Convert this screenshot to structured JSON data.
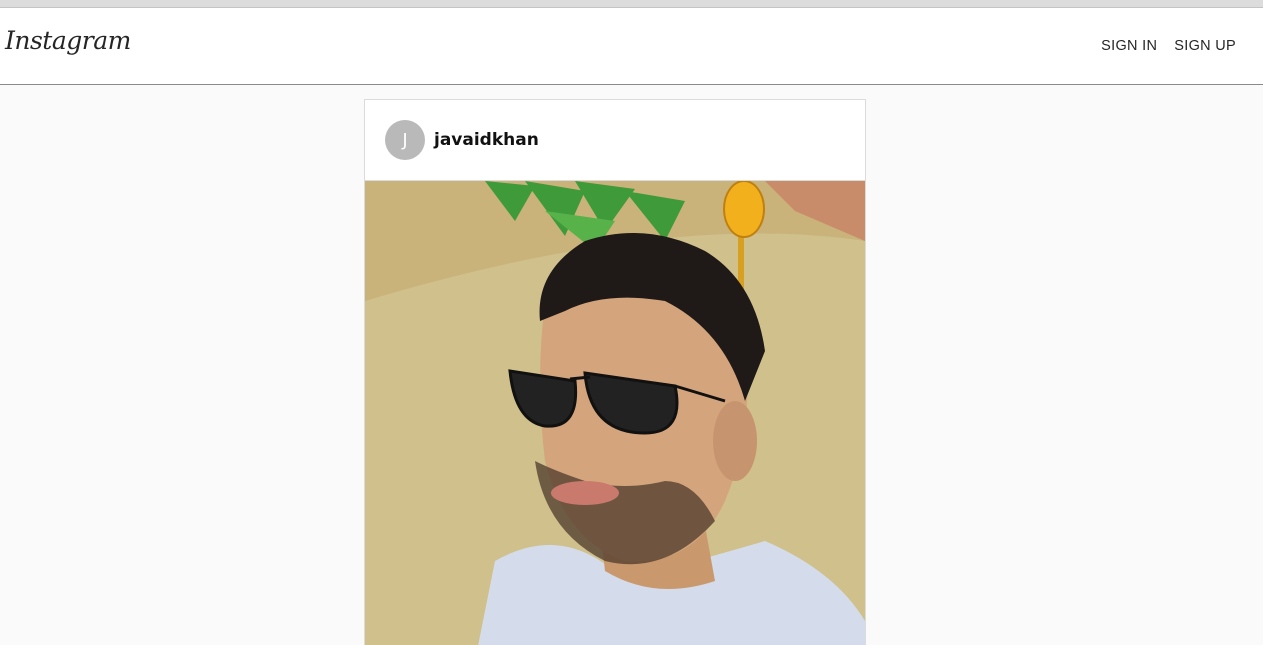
{
  "header": {
    "logo_text": "Instagram",
    "nav": [
      {
        "label": "SIGN IN"
      },
      {
        "label": "SIGN UP"
      }
    ]
  },
  "post": {
    "avatar_initial": "J",
    "username": "javaidkhan"
  },
  "colors": {
    "page_background": "#fafafa",
    "avatar_background": "#b9b9b9",
    "card_border": "#dbdbdb"
  }
}
